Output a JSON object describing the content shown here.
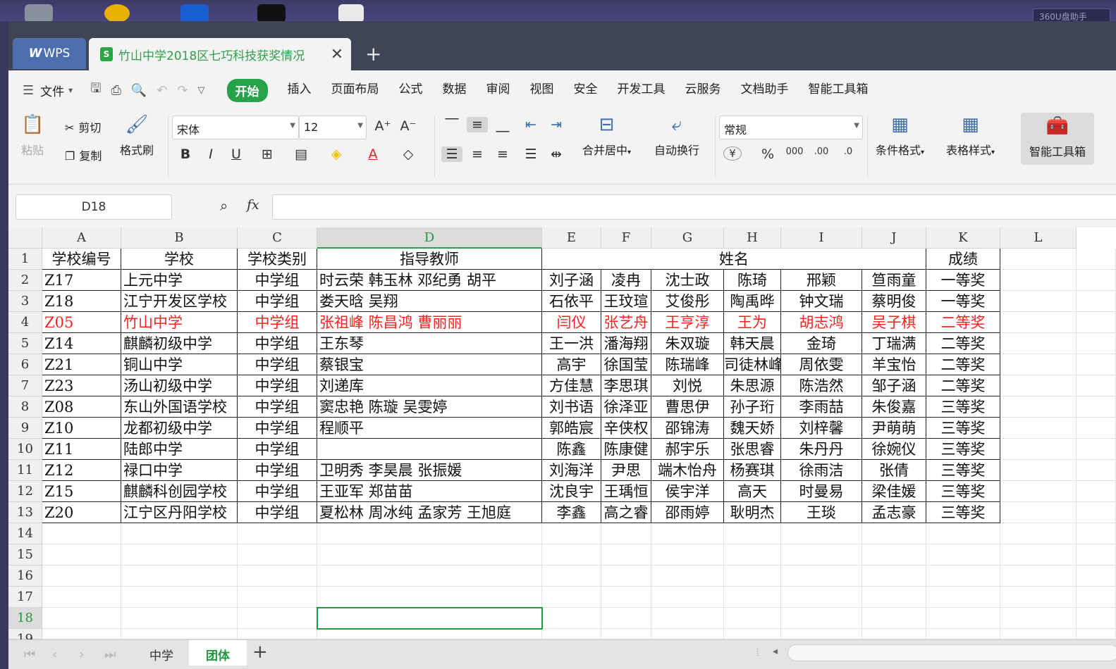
{
  "desktop": {
    "helper": "360U盘助手"
  },
  "tabs": {
    "wps_label": "WPS",
    "doc_title": "竹山中学2018区七巧科技获奖情况",
    "close": "✕",
    "new_tab": "+"
  },
  "menu": {
    "file": "文件",
    "items": [
      "开始",
      "插入",
      "页面布局",
      "公式",
      "数据",
      "审阅",
      "视图",
      "安全",
      "开发工具",
      "云服务",
      "文档助手",
      "智能工具箱"
    ]
  },
  "ribbon": {
    "paste": "粘贴",
    "cut": "剪切",
    "copy": "复制",
    "format_painter": "格式刷",
    "font_name": "宋体",
    "font_size": "12",
    "bold": "B",
    "italic": "I",
    "underline": "U",
    "merge_center": "合并居中",
    "wrap_text": "自动换行",
    "number_format": "常规",
    "currency": "¥",
    "percent": "%",
    "thousands": "000",
    "inc_decimal": ".00",
    "dec_decimal": ".0",
    "cond_format": "条件格式",
    "table_style": "表格样式",
    "smart_toolbox": "智能工具箱"
  },
  "formula_bar": {
    "name_box": "D18",
    "fx": "fx",
    "value": ""
  },
  "columns": [
    "A",
    "B",
    "C",
    "D",
    "E",
    "F",
    "G",
    "H",
    "I",
    "J",
    "K",
    "L"
  ],
  "row_numbers": [
    "1",
    "2",
    "3",
    "4",
    "5",
    "6",
    "7",
    "8",
    "9",
    "10",
    "11",
    "12",
    "13",
    "14",
    "15",
    "16",
    "17",
    "18",
    "19"
  ],
  "header_row": {
    "a": "学校编号",
    "b": "学校",
    "c": "学校类别",
    "d": "指导教师",
    "names": "姓名",
    "k": "成绩"
  },
  "rows": [
    {
      "a": "Z17",
      "b": "上元中学",
      "c": "中学组",
      "d": "时云荣  韩玉林  邓纪勇  胡平",
      "names": [
        "刘子涵",
        "凌冉",
        "沈士政",
        "陈琦",
        "邢颖",
        "笪雨童"
      ],
      "k": "一等奖",
      "highlight": false
    },
    {
      "a": "Z18",
      "b": "江宁开发区学校",
      "c": "中学组",
      "d": "娄天晗  吴翔",
      "names": [
        "石依平",
        "王玟瑄",
        "艾俊彤",
        "陶禹晔",
        "钟文瑞",
        "蔡明俊"
      ],
      "k": "一等奖",
      "highlight": false
    },
    {
      "a": "Z05",
      "b": "竹山中学",
      "c": "中学组",
      "d": "张祖峰  陈昌鸿  曹丽丽",
      "names": [
        "闫仪",
        "张艺舟",
        "王亨淳",
        "王为",
        "胡志鸿",
        "吴子棋"
      ],
      "k": "二等奖",
      "highlight": true
    },
    {
      "a": "Z14",
      "b": "麒麟初级中学",
      "c": "中学组",
      "d": "王东琴",
      "names": [
        "王一洪",
        "潘海翔",
        "朱双璇",
        "韩天晨",
        "金琦",
        "丁瑞满"
      ],
      "k": "二等奖",
      "highlight": false
    },
    {
      "a": "Z21",
      "b": "铜山中学",
      "c": "中学组",
      "d": "蔡银宝",
      "names": [
        "高宇",
        "徐国莹",
        "陈瑞峰",
        "司徒林峰",
        "周依雯",
        "羊宝怡"
      ],
      "k": "二等奖",
      "highlight": false
    },
    {
      "a": "Z23",
      "b": "汤山初级中学",
      "c": "中学组",
      "d": "刘递库",
      "names": [
        "方佳慧",
        "李思琪",
        "刘悦",
        "朱思源",
        "陈浩然",
        "邹子涵"
      ],
      "k": "二等奖",
      "highlight": false
    },
    {
      "a": "Z08",
      "b": "东山外国语学校",
      "c": "中学组",
      "d": "窦忠艳  陈璇  吴雯婷",
      "names": [
        "刘书语",
        "徐泽亚",
        "曹思伊",
        "孙子珩",
        "李雨喆",
        "朱俊嘉"
      ],
      "k": "三等奖",
      "highlight": false
    },
    {
      "a": "Z10",
      "b": "龙都初级中学",
      "c": "中学组",
      "d": "程顺平",
      "names": [
        "郭皓宸",
        "辛侠权",
        "邵锦涛",
        "魏天娇",
        "刘梓馨",
        "尹萌萌"
      ],
      "k": "三等奖",
      "highlight": false
    },
    {
      "a": "Z11",
      "b": "陆郎中学",
      "c": "中学组",
      "d": "",
      "names": [
        "陈鑫",
        "陈康健",
        "郝宇乐",
        "张思睿",
        "朱丹丹",
        "徐婉仪"
      ],
      "k": "三等奖",
      "highlight": false
    },
    {
      "a": "Z12",
      "b": "禄口中学",
      "c": "中学组",
      "d": "卫明秀  李昊晨  张振媛",
      "names": [
        "刘海洋",
        "尹思",
        "端木怡舟",
        "杨赛琪",
        "徐雨洁",
        "张倩"
      ],
      "k": "三等奖",
      "highlight": false
    },
    {
      "a": "Z15",
      "b": "麒麟科创园学校",
      "c": "中学组",
      "d": "王亚军  郑苗苗",
      "names": [
        "沈良宇",
        "王瑀恒",
        "侯宇洋",
        "高天",
        "时曼易",
        "梁佳媛"
      ],
      "k": "三等奖",
      "highlight": false
    },
    {
      "a": "Z20",
      "b": "江宁区丹阳学校",
      "c": "中学组",
      "d": "夏松林  周冰纯  孟家芳  王旭庭",
      "names": [
        "李鑫",
        "高之睿",
        "邵雨婷",
        "耿明杰",
        "王琰",
        "孟志豪"
      ],
      "k": "三等奖",
      "highlight": false
    }
  ],
  "sheets": [
    "中学",
    "团体"
  ],
  "active_sheet": "团体",
  "add_sheet": "+",
  "colors": {
    "accent": "#25a24a",
    "highlight_text": "#ff2020"
  }
}
